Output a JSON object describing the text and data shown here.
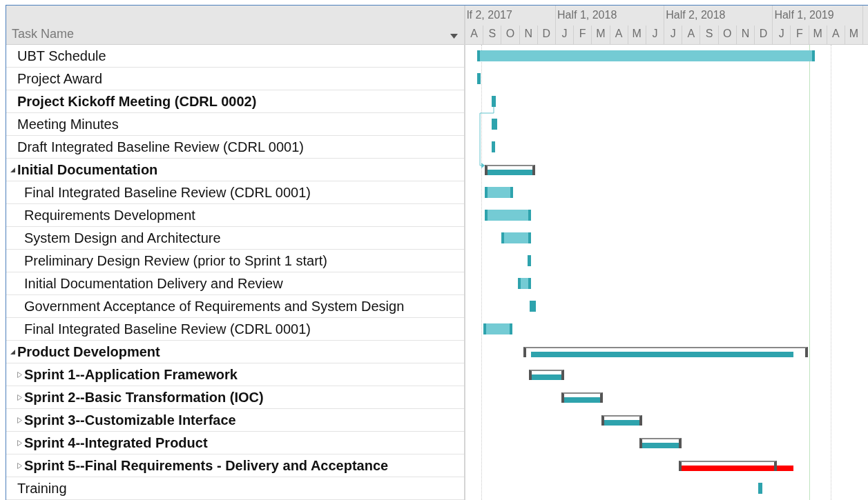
{
  "table": {
    "header": "Task Name"
  },
  "timeline": {
    "halves": [
      {
        "label": "lf 2, 2017",
        "months": [
          "A",
          "S",
          "O",
          "N",
          "D"
        ]
      },
      {
        "label": "Half 1, 2018",
        "months": [
          "J",
          "F",
          "M",
          "A",
          "M",
          "J"
        ]
      },
      {
        "label": "Half 2, 2018",
        "months": [
          "J",
          "A",
          "S",
          "O",
          "N",
          "D"
        ]
      },
      {
        "label": "Half 1, 2019",
        "months": [
          "J",
          "F",
          "M",
          "A",
          "M"
        ]
      }
    ]
  },
  "tasks": [
    {
      "name": "UBT Schedule",
      "kind": "task",
      "bold": false
    },
    {
      "name": "Project Award",
      "kind": "task",
      "bold": false
    },
    {
      "name": "Project Kickoff Meeting (CDRL 0002)",
      "kind": "task",
      "bold": true,
      "link": true
    },
    {
      "name": "Meeting Minutes",
      "kind": "task",
      "bold": false
    },
    {
      "name": "Draft Integrated Baseline Review (CDRL 0001)",
      "kind": "task",
      "bold": false
    },
    {
      "name": "Initial Documentation",
      "kind": "summary",
      "bold": true,
      "expanded": true,
      "color": "#2ea3ad",
      "children": [
        {
          "name": "Final Integrated Baseline Review (CDRL 0001)",
          "kind": "task",
          "bold": false
        },
        {
          "name": "Requirements Development",
          "kind": "task",
          "bold": false
        },
        {
          "name": "System Design and Architecture",
          "kind": "task",
          "bold": false
        },
        {
          "name": "Preliminary Design Review (prior to Sprint 1 start)",
          "kind": "task",
          "bold": false
        },
        {
          "name": "Initial Documentation Delivery and Review",
          "kind": "task",
          "bold": false
        },
        {
          "name": "Government Acceptance of Requirements and System Design",
          "kind": "task",
          "bold": false
        },
        {
          "name": "Final Integrated Baseline Review (CDRL 0001)",
          "kind": "task",
          "bold": false
        }
      ]
    },
    {
      "name": "Product Development",
      "kind": "summary",
      "bold": true,
      "expanded": true,
      "color": "#2ea3ad",
      "children": [
        {
          "name": "Sprint 1--Application Framework",
          "kind": "summary",
          "bold": true,
          "expanded": false,
          "color": "#2ea3ad"
        },
        {
          "name": "Sprint 2--Basic Transformation (IOC)",
          "kind": "summary",
          "bold": true,
          "expanded": false,
          "color": "#2ea3ad"
        },
        {
          "name": "Sprint 3--Customizable Interface",
          "kind": "summary",
          "bold": true,
          "expanded": false,
          "color": "#2ea3ad"
        },
        {
          "name": "Sprint 4--Integrated Product",
          "kind": "summary",
          "bold": true,
          "expanded": false,
          "color": "#2ea3ad"
        },
        {
          "name": "Sprint 5--Final Requirements - Delivery and Acceptance",
          "kind": "summary",
          "bold": true,
          "expanded": false,
          "color": "#ff0000"
        }
      ]
    },
    {
      "name": "Training",
      "kind": "task",
      "bold": false
    }
  ]
}
